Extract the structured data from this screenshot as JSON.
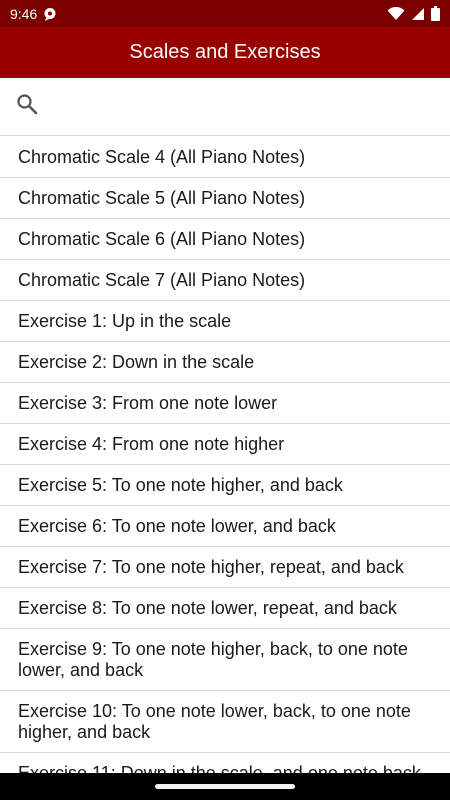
{
  "status_bar": {
    "time": "9:46",
    "notification_icon": "chat-bubble-icon",
    "wifi_icon": "wifi-icon",
    "signal_icon": "cell-signal-icon",
    "battery_icon": "battery-icon"
  },
  "app_bar": {
    "title": "Scales and Exercises"
  },
  "search": {
    "icon": "search-icon",
    "value": "",
    "placeholder": ""
  },
  "list": {
    "items": [
      "Chromatic Scale 4 (All Piano Notes)",
      "Chromatic Scale 5 (All Piano Notes)",
      "Chromatic Scale 6 (All Piano Notes)",
      "Chromatic Scale 7 (All Piano Notes)",
      "Exercise 1: Up in the scale",
      "Exercise 2: Down in the scale",
      "Exercise 3: From one note lower",
      "Exercise 4: From one note higher",
      "Exercise 5: To one note higher, and back",
      "Exercise 6: To one note lower, and back",
      "Exercise 7: To one note higher, repeat, and back",
      "Exercise 8: To one note lower, repeat, and back",
      "Exercise 9: To one note higher, back, to one note lower, and back",
      "Exercise 10: To one note lower, back, to one note higher, and back",
      "Exercise 11: Down in the scale, and one note back"
    ]
  },
  "colors": {
    "status_bar": "#7a0000",
    "app_bar": "#990000",
    "divider": "#dcdcdc",
    "text": "#1a1a1a"
  }
}
